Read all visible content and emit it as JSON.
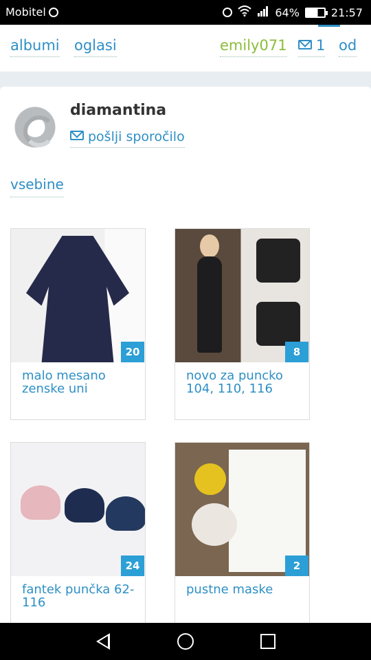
{
  "status_bar": {
    "carrier": "Mobitel",
    "battery": "64%",
    "time": "21:57",
    "icons": [
      "chrome-icon",
      "alarm-icon",
      "wifi-icon",
      "signal-icon",
      "battery-icon"
    ]
  },
  "nav": {
    "albumi": "albumi",
    "oglasi": "oglasi",
    "user": "emily071",
    "messages_count": "1",
    "od": "od"
  },
  "profile": {
    "name": "diamantina",
    "send_message": "pošlji sporočilo"
  },
  "section": {
    "label": "vsebine"
  },
  "albums": [
    {
      "title": "malo mesano zenske uni",
      "count": "20",
      "image": "navy dress on hanger"
    },
    {
      "title": "novo za puncko 104, 110, 116",
      "count": "8",
      "image": "girl in black outfit with shirts"
    },
    {
      "title": "fantek punčka 62-116",
      "count": "24",
      "image": "three children's caps"
    },
    {
      "title": "pustne maske",
      "count": "2",
      "image": "white costume with masks"
    }
  ],
  "colors": {
    "link": "#2e8fc6",
    "user": "#8cbc3a",
    "badge": "#2b9fd6",
    "background": "#e8edf2"
  }
}
